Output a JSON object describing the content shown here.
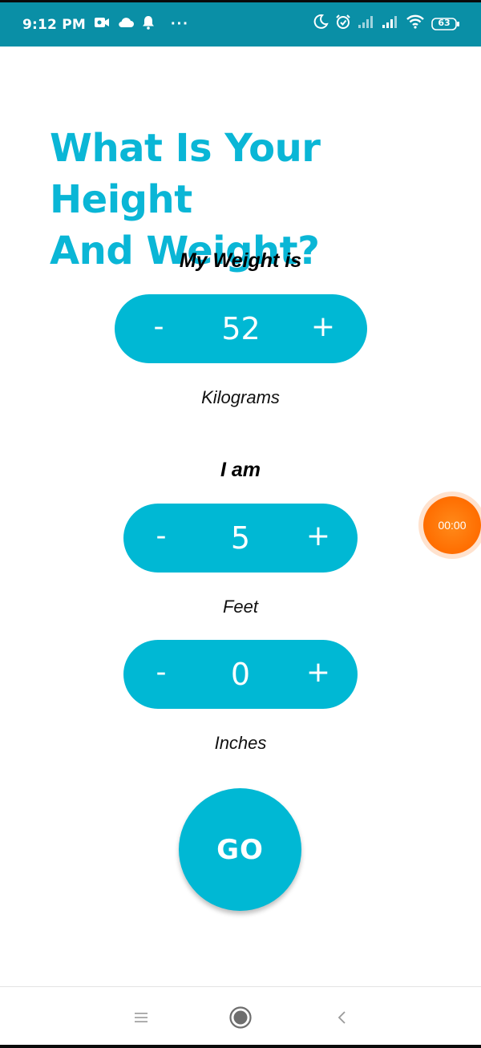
{
  "status_bar": {
    "time": "9:12 PM",
    "more": "···",
    "battery": "63",
    "color": "#0a8fa6",
    "left_icons": [
      "video-camera-icon",
      "cloud-icon",
      "bell-icon"
    ],
    "right_icons": [
      "moon-icon",
      "alarm-icon",
      "signal-icon",
      "signal-icon",
      "wifi-icon",
      "battery-icon"
    ]
  },
  "title_line1": "What Is Your Height",
  "title_line2": "And Weight?",
  "weight": {
    "heading": "My Weight is",
    "minus": "-",
    "value": "52",
    "plus": "+",
    "unit": "Kilograms"
  },
  "height": {
    "heading": "I am",
    "feet": {
      "minus": "-",
      "value": "5",
      "plus": "+",
      "unit": "Feet"
    },
    "inches": {
      "minus": "-",
      "value": "0",
      "plus": "+",
      "unit": "Inches"
    }
  },
  "go_label": "GO",
  "timer_label": "00:00",
  "accent_color": "#00b8d4",
  "title_color": "#0ab6d6",
  "nav": {
    "icons": [
      "menu-icon",
      "home-icon",
      "back-icon"
    ]
  }
}
